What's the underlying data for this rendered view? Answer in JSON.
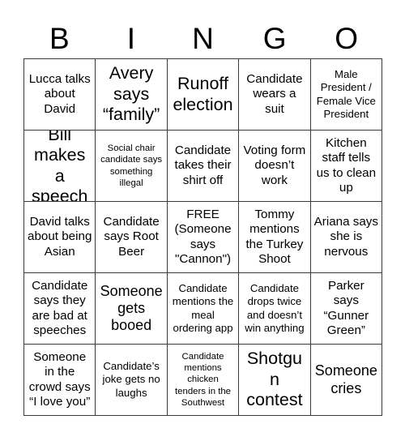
{
  "header": {
    "letters": [
      "B",
      "I",
      "N",
      "G",
      "O"
    ]
  },
  "grid": {
    "rows": [
      {
        "cells": [
          {
            "text": "Lucca talks about David",
            "size": "md"
          },
          {
            "text": "Avery says “family”",
            "size": "xl"
          },
          {
            "text": "Runoff election",
            "size": "xl"
          },
          {
            "text": "Candidate wears a suit",
            "size": "md"
          },
          {
            "text": "Male President / Female Vice President",
            "size": "sm"
          }
        ]
      },
      {
        "cells": [
          {
            "text": "Bill makes a speech",
            "size": "xl"
          },
          {
            "text": "Social chair candidate says something illegal",
            "size": "xs"
          },
          {
            "text": "Candidate takes their shirt off",
            "size": "md"
          },
          {
            "text": "Voting form doesn’t work",
            "size": "md"
          },
          {
            "text": "Kitchen staff tells us to clean up",
            "size": "md"
          }
        ]
      },
      {
        "cells": [
          {
            "text": "David talks about being Asian",
            "size": "md"
          },
          {
            "text": "Candidate says Root Beer",
            "size": "md"
          },
          {
            "text": "FREE (Someone says \"Cannon\")",
            "size": "md"
          },
          {
            "text": "Tommy mentions the Turkey Shoot",
            "size": "md"
          },
          {
            "text": "Ariana says she is nervous",
            "size": "md"
          }
        ]
      },
      {
        "cells": [
          {
            "text": "Candidate says they are bad at speeches",
            "size": "md"
          },
          {
            "text": "Someone gets booed",
            "size": "lg"
          },
          {
            "text": "Candidate mentions the meal ordering app",
            "size": "sm"
          },
          {
            "text": "Candidate drops twice and doesn’t win anything",
            "size": "sm"
          },
          {
            "text": "Parker says “Gunner Green”",
            "size": "md"
          }
        ]
      },
      {
        "cells": [
          {
            "text": "Someone in the crowd says “I love you”",
            "size": "md"
          },
          {
            "text": "Candidate’s joke gets no laughs",
            "size": "sm"
          },
          {
            "text": "Candidate mentions chicken tenders in the Southwest",
            "size": "xs"
          },
          {
            "text": "Shotgun contest",
            "size": "xl"
          },
          {
            "text": "Someone cries",
            "size": "lg"
          }
        ]
      }
    ]
  },
  "colors": {
    "background": "#ffffff",
    "text": "#000000",
    "border": "#3a3a3a"
  }
}
